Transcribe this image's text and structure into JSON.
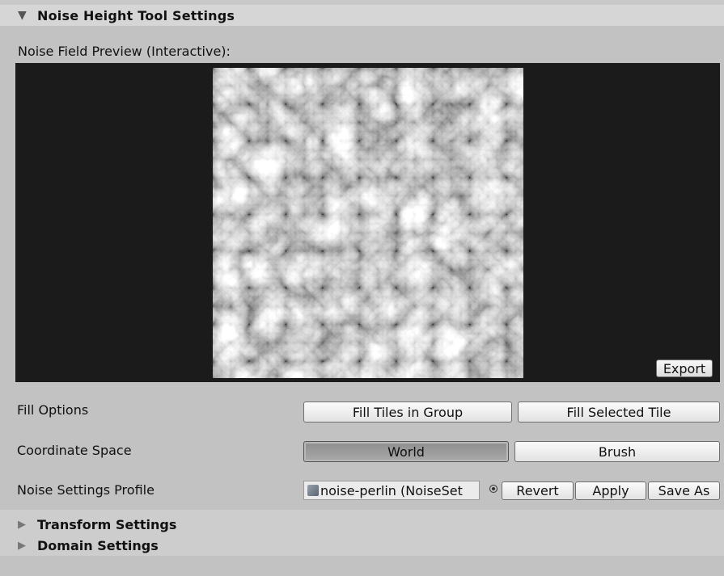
{
  "panel": {
    "title": "Noise Height Tool Settings",
    "expand_icon": "triangle-down-icon"
  },
  "preview": {
    "label": "Noise Field Preview (Interactive):",
    "export_label": "Export"
  },
  "fill_options": {
    "label": "Fill Options",
    "fill_group_label": "Fill Tiles in Group",
    "fill_selected_label": "Fill Selected Tile"
  },
  "coordinate_space": {
    "label": "Coordinate Space",
    "world_label": "World",
    "brush_label": "Brush",
    "selected": "World"
  },
  "noise_profile": {
    "label": "Noise Settings Profile",
    "value": "noise-perlin (NoiseSet",
    "revert_label": "Revert",
    "apply_label": "Apply",
    "save_as_label": "Save As"
  },
  "sections": [
    {
      "title": "Transform Settings",
      "icon": "triangle-right-icon"
    },
    {
      "title": "Domain Settings",
      "icon": "triangle-right-icon"
    }
  ]
}
